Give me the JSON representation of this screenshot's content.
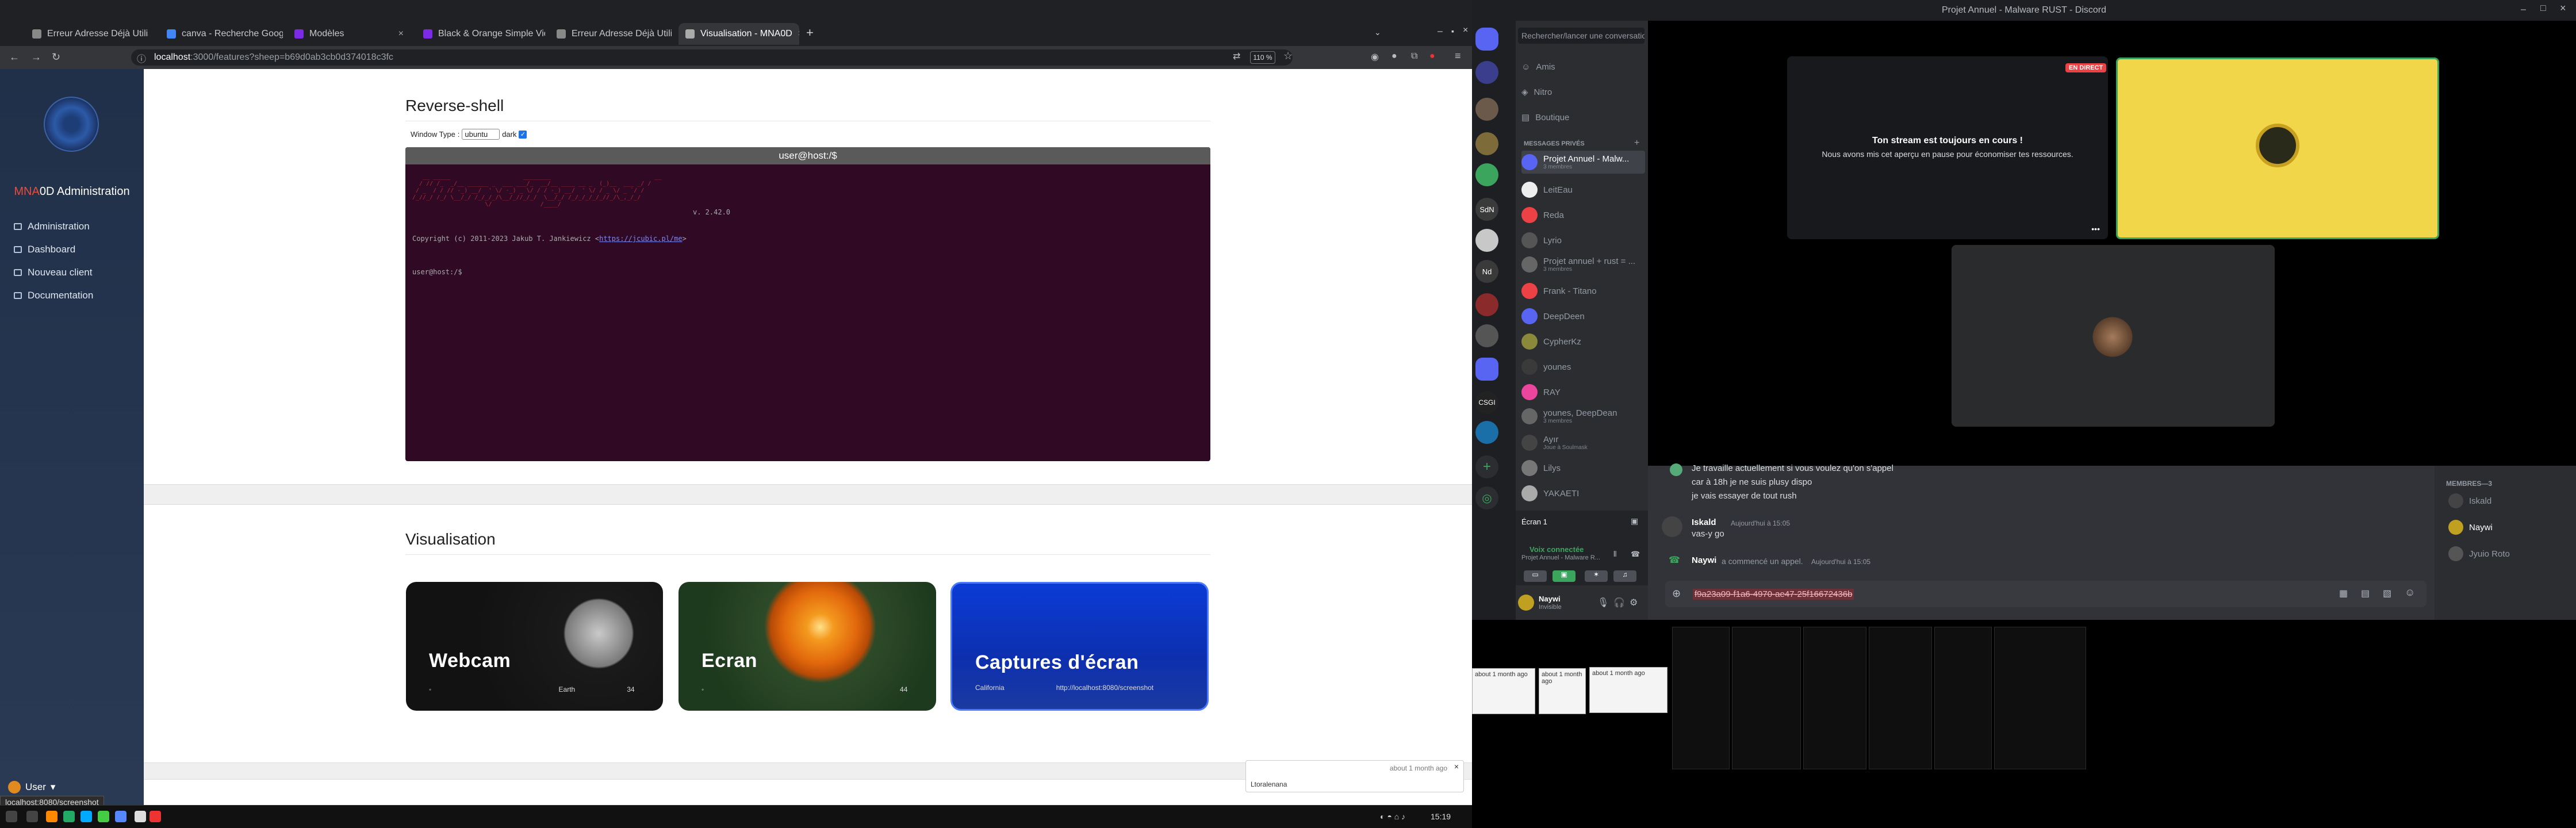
{
  "browser": {
    "tabs": [
      {
        "label": "Erreur Adresse Déjà Utilisée",
        "active": false
      },
      {
        "label": "canva - Recherche Google",
        "active": false
      },
      {
        "label": "Modèles",
        "active": false
      },
      {
        "label": "Black & Orange Simple Video",
        "active": false
      },
      {
        "label": "Erreur Adresse Déjà Utilisée",
        "active": false
      },
      {
        "label": "Visualisation - MNA0D",
        "active": true
      }
    ],
    "new_tab": "+",
    "url_host": "localhost",
    "url_path": ":3000/features?sheep=b69d0ab3cb0d374018c3fc",
    "zoom": "110 %"
  },
  "sidebar": {
    "brand_prefix": "MNA",
    "brand_rest": "0D Administration",
    "items": [
      {
        "label": "Administration",
        "icon": "folder-icon"
      },
      {
        "label": "Dashboard",
        "icon": "folder-icon"
      },
      {
        "label": "Nouveau client",
        "icon": "folder-icon"
      },
      {
        "label": "Documentation",
        "icon": "folder-icon"
      }
    ],
    "user_label": "User"
  },
  "reverse_shell": {
    "title": "Reverse-shell",
    "window_type_label": "Window Type",
    "window_type_value": "ubuntu",
    "dark_label": "dark",
    "terminal_title": "user@host:/$",
    "copyright": "Copyright (c) 2011-2023 Jakub T. Jankiewicz <",
    "copyright_link": "https://jcubic.pl/me",
    "copyright_end": ">",
    "version": "v. 2.42.0",
    "prompt": "user@host:/$"
  },
  "visualisation": {
    "title": "Visualisation",
    "cards": [
      {
        "title": "Webcam",
        "meta_left": "◦",
        "meta_mid": "Earth",
        "meta_right": "34"
      },
      {
        "title": "Ecran",
        "meta_left": "◦",
        "meta_mid": "",
        "meta_right": "44"
      },
      {
        "title": "Captures d'écran",
        "meta_left": "California",
        "meta_mid": "http://localhost:8080/screenshot",
        "meta_right": ""
      }
    ]
  },
  "notification": {
    "time": "about 1 month ago",
    "body": "Ltoralenana"
  },
  "status_url": "localhost:8080/screenshot",
  "taskbar": {
    "clock": "15:19"
  },
  "discord": {
    "window_title": "Projet Annuel - Malware RUST - Discord",
    "search_placeholder": "Rechercher/lancer une conversation",
    "top_items": [
      "Amis",
      "Nitro",
      "Boutique"
    ],
    "dm_header": "MESSAGES PRIVÉS",
    "dms": [
      {
        "name": "Projet Annuel - Malw...",
        "sub": "3 membres",
        "selected": true
      },
      {
        "name": "LeitEau",
        "sub": ""
      },
      {
        "name": "Reda",
        "sub": ""
      },
      {
        "name": "Lyrio",
        "sub": ""
      },
      {
        "name": "Projet annuel + rust = ...",
        "sub": "3 membres"
      },
      {
        "name": "Frank - Titano",
        "sub": ""
      },
      {
        "name": "DeepDeen",
        "sub": ""
      },
      {
        "name": "CypherKz",
        "sub": ""
      },
      {
        "name": "younes",
        "sub": ""
      },
      {
        "name": "RAY",
        "sub": ""
      },
      {
        "name": "younes, DeepDean",
        "sub": "3 membres"
      },
      {
        "name": "Ayır",
        "sub": "Joue à Soulmask"
      },
      {
        "name": "Lilys",
        "sub": ""
      },
      {
        "name": "YAKAETI",
        "sub": ""
      }
    ],
    "screen_label": "Écran 1",
    "voice_status": "Voix connectée",
    "voice_channel": "Projet Annuel - Malware R...",
    "user_name": "Naywi",
    "user_status": "Invisible",
    "live_badge": "EN DIRECT",
    "stream_paused_title": "Ton stream est toujours en cours !",
    "stream_paused_body": "Nous avons mis cet aperçu en pause pour économiser tes ressources.",
    "messages": [
      {
        "text": "Je travaille actuellement si vous voulez qu'on s'appel"
      },
      {
        "text": "car à 18h je ne suis plusy dispo"
      },
      {
        "text": "je vais essayer de tout rush"
      }
    ],
    "msg_author": "Iskald",
    "msg_time": "Aujourd'hui à 15:05",
    "msg_text": "vas-y go",
    "call_author": "Naywi",
    "call_text": "a commencé un appel.",
    "call_time": "Aujourd'hui à 15:05",
    "input_text": "f9a23a09-f1a6-4970-ae47-25f16672436b",
    "members_header": "MEMBRES—3",
    "members": [
      {
        "name": "Iskald"
      },
      {
        "name": "Naywi"
      },
      {
        "name": "Jyuio Roto"
      }
    ]
  },
  "mini_windows": {
    "time1": "about 1 month ago",
    "time2": "about 1 month ago",
    "time3": "about 1 month ago"
  },
  "colors": {
    "accent": "#1a73e8",
    "discord_green": "#3ba55d",
    "terminal_bg": "#300a24",
    "brand_red": "#e74c3c"
  }
}
